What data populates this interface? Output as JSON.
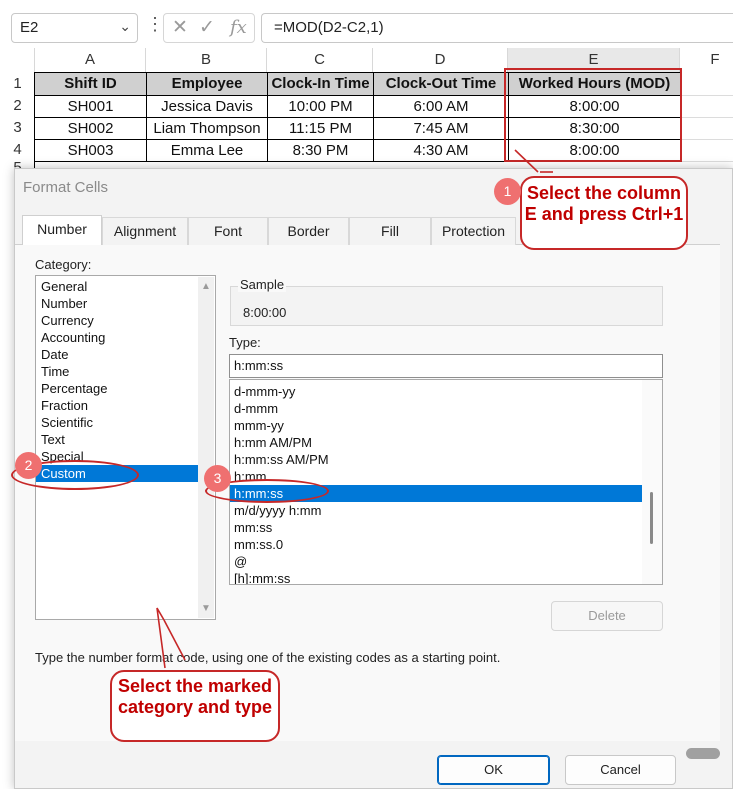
{
  "formula_bar": {
    "name_box": "E2",
    "formula": "=MOD(D2-C2,1)"
  },
  "columns": [
    "A",
    "B",
    "C",
    "D",
    "E",
    "F"
  ],
  "rows": [
    "1",
    "2",
    "3",
    "4",
    "5"
  ],
  "sheet": {
    "headers": [
      "Shift ID",
      "Employee",
      "Clock-In Time",
      "Clock-Out Time",
      "Worked Hours (MOD)"
    ],
    "data": [
      [
        "SH001",
        "Jessica Davis",
        "10:00 PM",
        "6:00 AM",
        "8:00:00"
      ],
      [
        "SH002",
        "Liam Thompson",
        "11:15 PM",
        "7:45 AM",
        "8:30:00"
      ],
      [
        "SH003",
        "Emma Lee",
        "8:30 PM",
        "4:30 AM",
        "8:00:00"
      ]
    ]
  },
  "dialog": {
    "title": "Format Cells",
    "tabs": [
      "Number",
      "Alignment",
      "Font",
      "Border",
      "Fill",
      "Protection"
    ],
    "category_label": "Category:",
    "categories": [
      "General",
      "Number",
      "Currency",
      "Accounting",
      "Date",
      "Time",
      "Percentage",
      "Fraction",
      "Scientific",
      "Text",
      "Special",
      "Custom"
    ],
    "selected_category": "Custom",
    "sample_label": "Sample",
    "sample_value": "8:00:00",
    "type_label": "Type:",
    "type_value": "h:mm:ss",
    "types": [
      "d-mmm-yy",
      "d-mmm",
      "mmm-yy",
      "h:mm AM/PM",
      "h:mm:ss AM/PM",
      "h:mm",
      "h:mm:ss",
      "m/d/yyyy h:mm",
      "mm:ss",
      "mm:ss.0",
      "@",
      "[h]:mm:ss"
    ],
    "selected_type": "h:mm:ss",
    "delete_label": "Delete",
    "hint": "Type the number format code, using one of the existing codes as a starting point.",
    "ok_label": "OK",
    "cancel_label": "Cancel"
  },
  "annotations": {
    "callout1": "Select the column E and press Ctrl+1",
    "callout2": "Select the marked category and type",
    "badges": [
      "1",
      "2",
      "3"
    ]
  },
  "colors": {
    "accent_red": "#c62828",
    "selection_blue": "#0078d7",
    "header_gray": "#d0d0d0"
  }
}
